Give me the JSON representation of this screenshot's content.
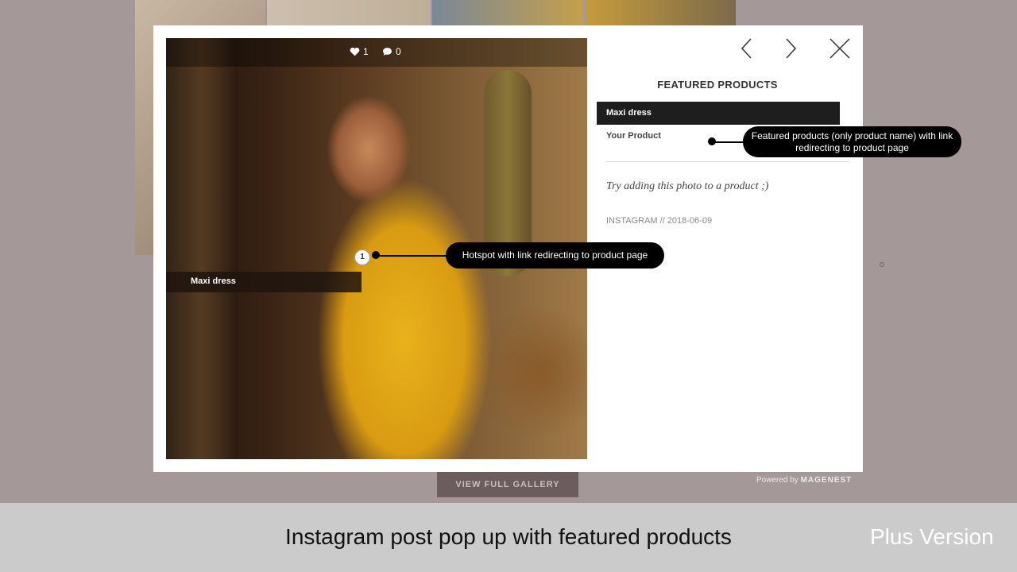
{
  "post": {
    "likes": "1",
    "comments": "0",
    "hotspot_number": "1",
    "hotspot_label": "Maxi dress"
  },
  "featured": {
    "title": "FEATURED PRODUCTS",
    "products": [
      "Maxi dress",
      "Your Product"
    ],
    "try_text": "Try adding this photo to a product ;)",
    "source": "INSTAGRAM // 2018-06-09"
  },
  "callouts": {
    "featured_products": "Featured products (only product name) with link redirecting to product page",
    "hotspot": "Hotspot with link redirecting to product page"
  },
  "footer": {
    "gallery_button": "VIEW FULL GALLERY",
    "powered_prefix": "Powered by",
    "powered_brand": "MAGENEST"
  },
  "caption": {
    "text": "Instagram post pop up with featured products",
    "version": "Plus Version"
  },
  "icons": {
    "heart": "heart-icon",
    "comment": "comment-icon",
    "prev": "chevron-left-icon",
    "next": "chevron-right-icon",
    "close": "close-icon"
  }
}
